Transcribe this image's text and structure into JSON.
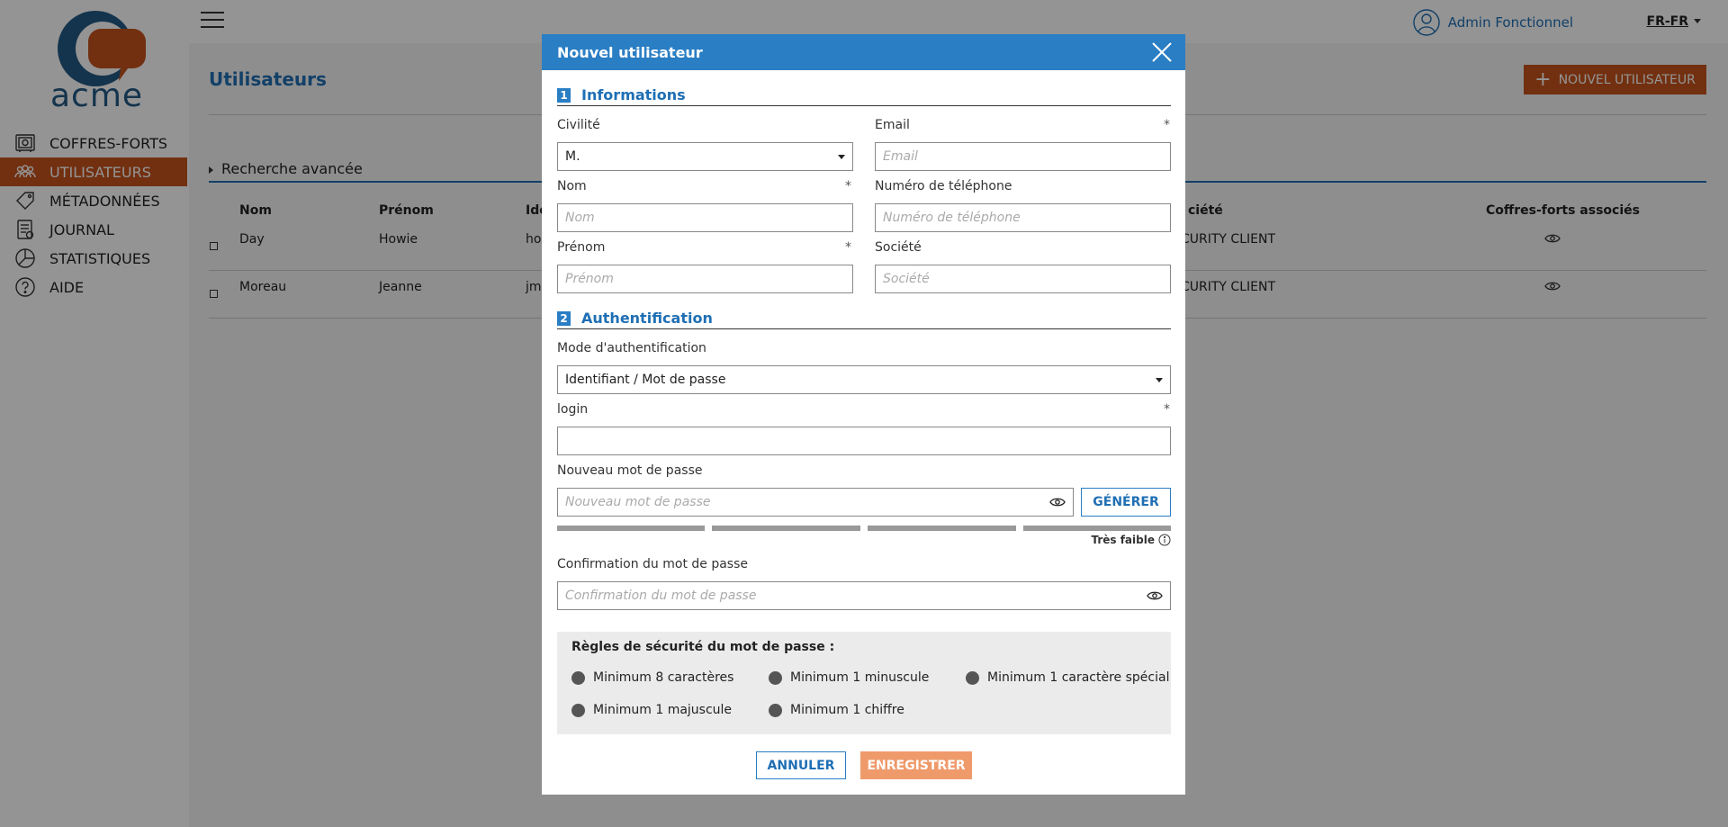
{
  "brand": {
    "logo_text": "acme"
  },
  "sidebar": {
    "items": [
      {
        "label": "COFFRES-FORTS",
        "icon": "safe-icon",
        "active": false
      },
      {
        "label": "UTILISATEURS",
        "icon": "users-icon",
        "active": true
      },
      {
        "label": "MÉTADONNÉES",
        "icon": "tag-icon",
        "active": false
      },
      {
        "label": "JOURNAL",
        "icon": "journal-icon",
        "active": false
      },
      {
        "label": "STATISTIQUES",
        "icon": "pie-chart-icon",
        "active": false
      },
      {
        "label": "AIDE",
        "icon": "help-icon",
        "active": false
      }
    ]
  },
  "header": {
    "user_name": "Admin Fonctionnel",
    "language": "FR-FR"
  },
  "main": {
    "title": "Utilisateurs",
    "add_button_label": "NOUVEL UTILISATEUR",
    "advanced_search_label": "Recherche avancée",
    "columns": [
      "Nom",
      "Prénom",
      "Ide",
      "ciété",
      "Coffres-forts associés"
    ],
    "rows": [
      {
        "nom": "Day",
        "prenom": "Howie",
        "ident": "ho",
        "societe": "CURITY CLIENT"
      },
      {
        "nom": "Moreau",
        "prenom": "Jeanne",
        "ident": "jm",
        "societe": "CURITY CLIENT"
      }
    ]
  },
  "modal": {
    "title": "Nouvel utilisateur",
    "section1": {
      "number": "1",
      "title": "Informations"
    },
    "section2": {
      "number": "2",
      "title": "Authentification"
    },
    "civilite": {
      "label": "Civilité",
      "value": "M."
    },
    "email": {
      "label": "Email",
      "placeholder": "Email",
      "required_mark": "*"
    },
    "nom": {
      "label": "Nom",
      "placeholder": "Nom",
      "required_mark": "*"
    },
    "telephone": {
      "label": "Numéro de téléphone",
      "placeholder": "Numéro de téléphone"
    },
    "prenom": {
      "label": "Prénom",
      "placeholder": "Prénom",
      "required_mark": "*"
    },
    "societe": {
      "label": "Société",
      "placeholder": "Société"
    },
    "auth_mode": {
      "label": "Mode d'authentification",
      "value": "Identifiant / Mot de passe"
    },
    "login": {
      "label": "login",
      "value": "",
      "required_mark": "*"
    },
    "new_password": {
      "label": "Nouveau mot de passe",
      "placeholder": "Nouveau mot de passe"
    },
    "generate_label": "GÉNÉRER",
    "strength": {
      "label": "Très faible",
      "segments": 4,
      "filled": 0
    },
    "confirm_password": {
      "label": "Confirmation du mot de passe",
      "placeholder": "Confirmation du mot de passe"
    },
    "rules": {
      "title": "Règles de sécurité du mot de passe :",
      "items": [
        "Minimum 8 caractères",
        "Minimum 1 minuscule",
        "Minimum 1 caractère spécial",
        "Minimum 1 majuscule",
        "Minimum 1 chiffre"
      ]
    },
    "cancel_label": "ANNULER",
    "save_label": "ENREGISTRER"
  },
  "colors": {
    "brand_orange": "#c4541c",
    "primary_blue": "#2a7ec4",
    "disabled_save": "#ef9a6b"
  }
}
